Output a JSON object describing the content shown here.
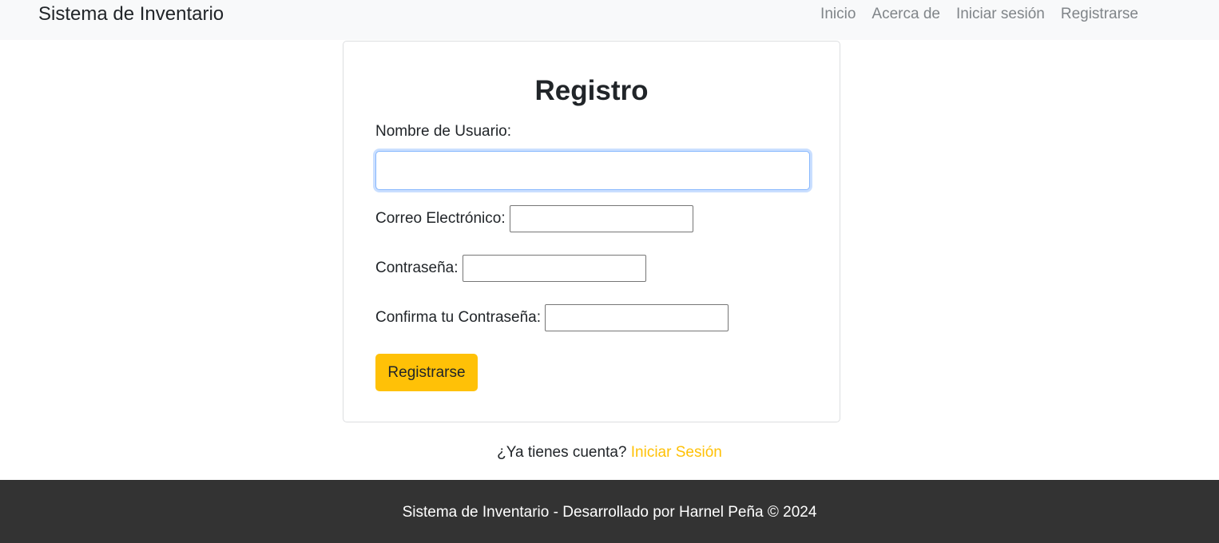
{
  "navbar": {
    "brand": "Sistema de Inventario",
    "links": [
      "Inicio",
      "Acerca de",
      "Iniciar sesión",
      "Registrarse"
    ]
  },
  "form": {
    "title": "Registro",
    "username_label": "Nombre de Usuario:",
    "username_value": "",
    "email_label": "Correo Electrónico:",
    "email_value": "",
    "password_label": "Contraseña:",
    "password_value": "",
    "confirm_label": "Confirma tu Contraseña:",
    "confirm_value": "",
    "submit_label": "Registrarse"
  },
  "login_prompt": {
    "text": "¿Ya tienes cuenta?",
    "link": "Iniciar Sesión"
  },
  "footer": {
    "text": "Sistema de Inventario - Desarrollado por Harnel Peña © 2024"
  },
  "colors": {
    "accent": "#ffc107",
    "navbar_bg": "#f8f9fa",
    "footer_bg": "#333333"
  }
}
